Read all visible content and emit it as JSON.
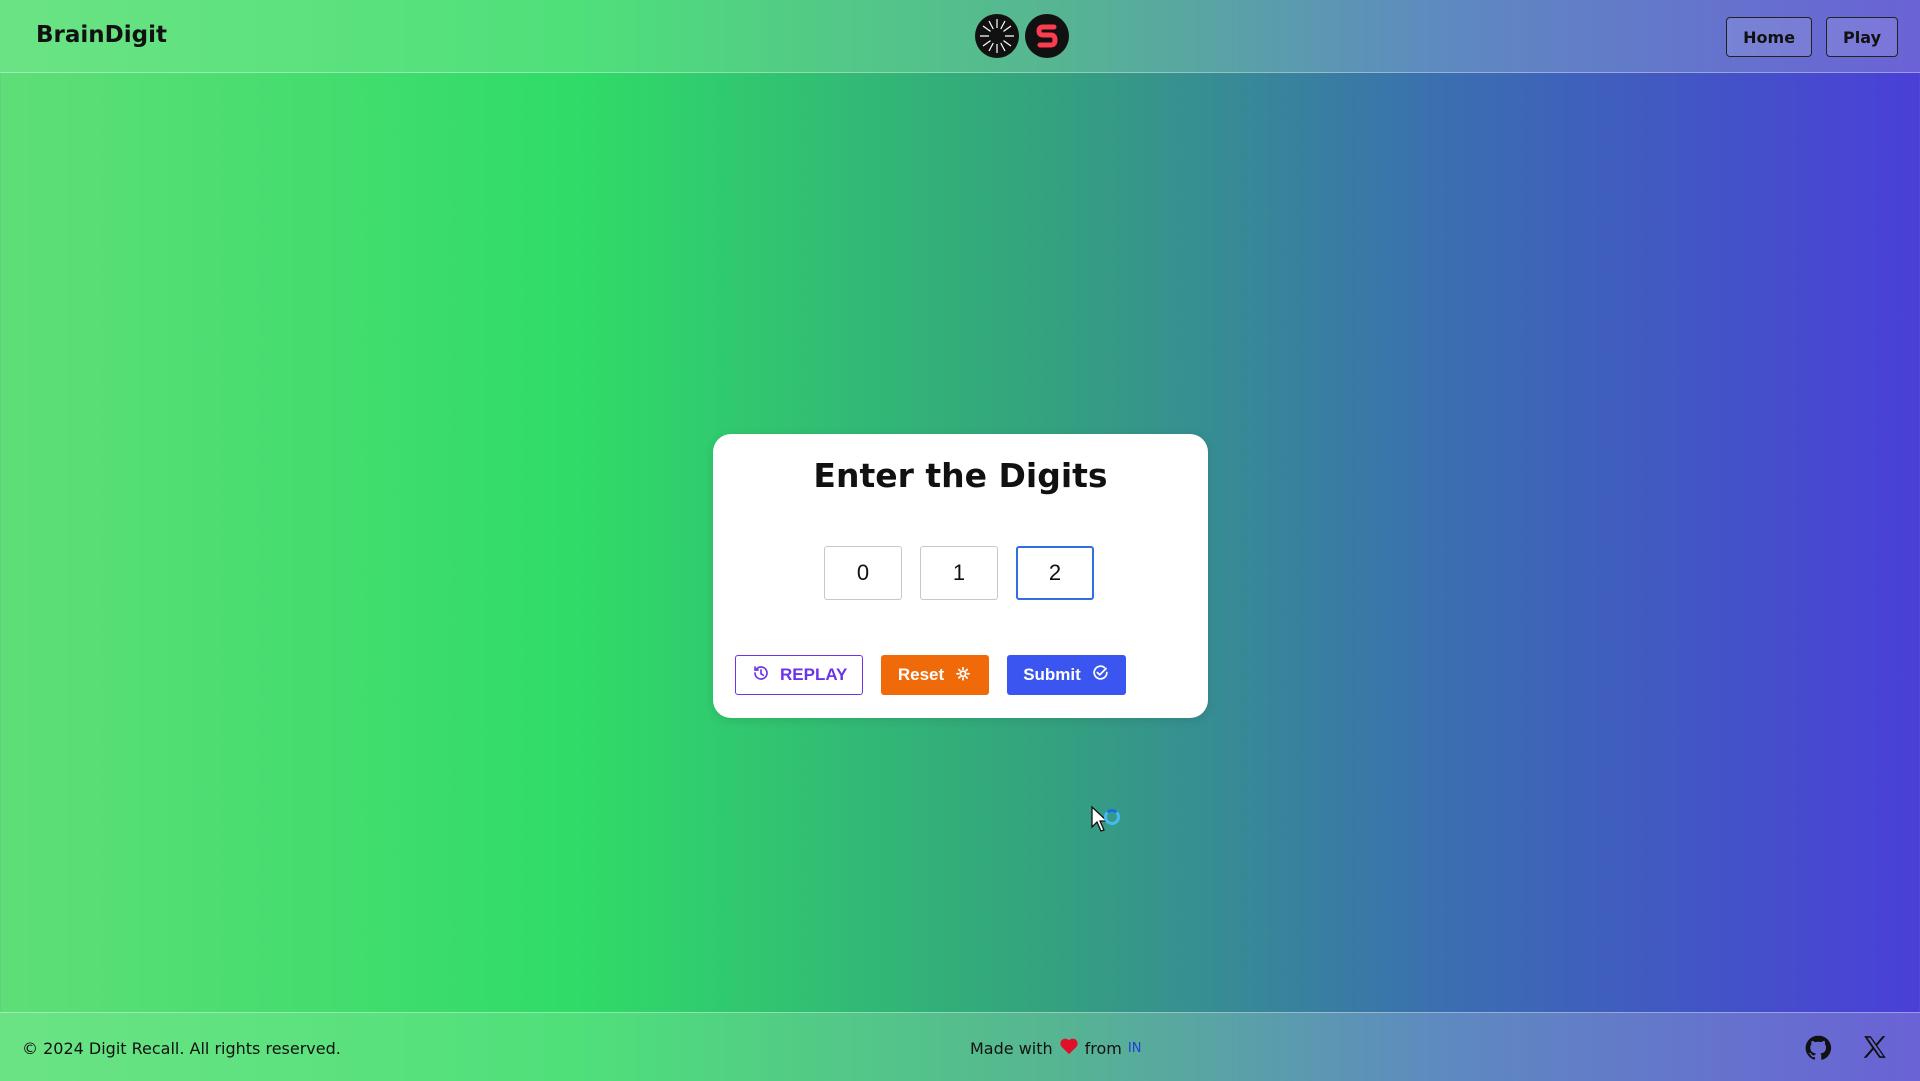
{
  "header": {
    "brand": "BrainDigit",
    "nav": {
      "home_label": "Home",
      "play_label": "Play"
    },
    "logos": [
      "sunburst-logo-icon",
      "s-logo-icon"
    ]
  },
  "game": {
    "title": "Enter the Digits",
    "digits": [
      "0",
      "1",
      "2"
    ],
    "active_index": 2,
    "replay_label": "REPLAY",
    "reset_label": "Reset",
    "submit_label": "Submit"
  },
  "footer": {
    "copyright": "© 2024 Digit Recall. All rights reserved.",
    "made_with": "Made with",
    "from": "from",
    "country_code": "IN",
    "social": [
      "github-icon",
      "x-icon"
    ]
  },
  "colors": {
    "replay": "#6a35e8",
    "reset": "#f06a0a",
    "submit": "#3b55f0",
    "heart": "#e0102a",
    "active_border": "#2f6fe0"
  }
}
